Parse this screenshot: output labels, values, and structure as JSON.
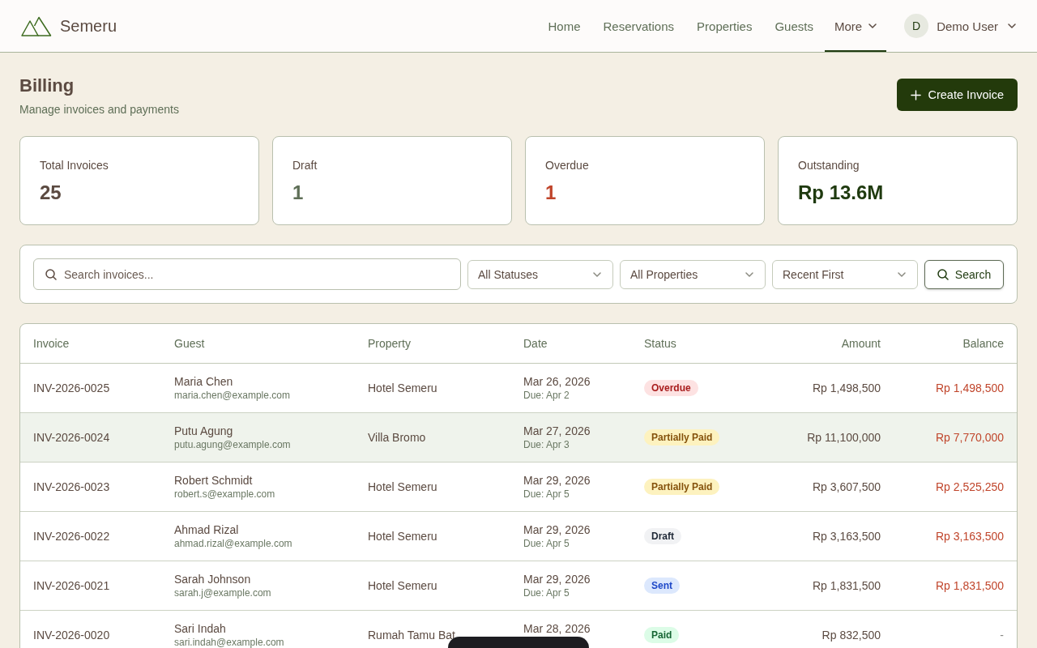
{
  "header": {
    "brand": "Semeru",
    "nav": [
      {
        "label": "Home",
        "kind": "link",
        "selected": false
      },
      {
        "label": "Reservations",
        "kind": "link",
        "selected": false
      },
      {
        "label": "Properties",
        "kind": "link",
        "selected": false
      },
      {
        "label": "Guests",
        "kind": "link",
        "selected": false
      },
      {
        "label": "More",
        "kind": "menu",
        "selected": true
      }
    ],
    "user": {
      "initial": "D",
      "name": "Demo User"
    }
  },
  "page": {
    "title": "Billing",
    "subtitle": "Manage invoices and payments",
    "primary_action": "Create Invoice"
  },
  "stats": [
    {
      "label": "Total Invoices",
      "value": "25",
      "color": "#5b4a41"
    },
    {
      "label": "Draft",
      "value": "1",
      "color": "#5f6f57"
    },
    {
      "label": "Overdue",
      "value": "1",
      "color": "#c0452b"
    },
    {
      "label": "Outstanding",
      "value": "Rp 13.6M",
      "color": "#1f3a0f"
    }
  ],
  "filters": {
    "search_placeholder": "Search invoices...",
    "selects": [
      "All Statuses",
      "All Properties",
      "Recent First"
    ],
    "search_button": "Search"
  },
  "table": {
    "columns": [
      "Invoice",
      "Guest",
      "Property",
      "Date",
      "Status",
      "Amount",
      "Balance"
    ],
    "rows": [
      {
        "invoice": "INV-2026-0025",
        "guest": "Maria Chen",
        "email": "maria.chen@example.com",
        "property": "Hotel Semeru",
        "date": "Mar 26, 2026",
        "due": "Due: Apr 2",
        "status": {
          "label": "Overdue",
          "kind": "overdue"
        },
        "amount": "Rp 1,498,500",
        "balance": "Rp 1,498,500",
        "outstanding": true,
        "selected": false
      },
      {
        "invoice": "INV-2026-0024",
        "guest": "Putu Agung",
        "email": "putu.agung@example.com",
        "property": "Villa Bromo",
        "date": "Mar 27, 2026",
        "due": "Due: Apr 3",
        "status": {
          "label": "Partially Paid",
          "kind": "partial"
        },
        "amount": "Rp 11,100,000",
        "balance": "Rp 7,770,000",
        "outstanding": true,
        "selected": true
      },
      {
        "invoice": "INV-2026-0023",
        "guest": "Robert Schmidt",
        "email": "robert.s@example.com",
        "property": "Hotel Semeru",
        "date": "Mar 29, 2026",
        "due": "Due: Apr 5",
        "status": {
          "label": "Partially Paid",
          "kind": "partial"
        },
        "amount": "Rp 3,607,500",
        "balance": "Rp 2,525,250",
        "outstanding": true,
        "selected": false
      },
      {
        "invoice": "INV-2026-0022",
        "guest": "Ahmad Rizal",
        "email": "ahmad.rizal@example.com",
        "property": "Hotel Semeru",
        "date": "Mar 29, 2026",
        "due": "Due: Apr 5",
        "status": {
          "label": "Draft",
          "kind": "draft"
        },
        "amount": "Rp 3,163,500",
        "balance": "Rp 3,163,500",
        "outstanding": true,
        "selected": false
      },
      {
        "invoice": "INV-2026-0021",
        "guest": "Sarah Johnson",
        "email": "sarah.j@example.com",
        "property": "Hotel Semeru",
        "date": "Mar 29, 2026",
        "due": "Due: Apr 5",
        "status": {
          "label": "Sent",
          "kind": "sent"
        },
        "amount": "Rp 1,831,500",
        "balance": "Rp 1,831,500",
        "outstanding": true,
        "selected": false
      },
      {
        "invoice": "INV-2026-0020",
        "guest": "Sari Indah",
        "email": "sari.indah@example.com",
        "property": "Rumah Tamu Bat",
        "date": "Mar 28, 2026",
        "status": {
          "label": "Paid",
          "kind": "paid"
        },
        "amount": "Rp 832,500",
        "balance": "-",
        "outstanding": false,
        "selected": false
      }
    ]
  }
}
